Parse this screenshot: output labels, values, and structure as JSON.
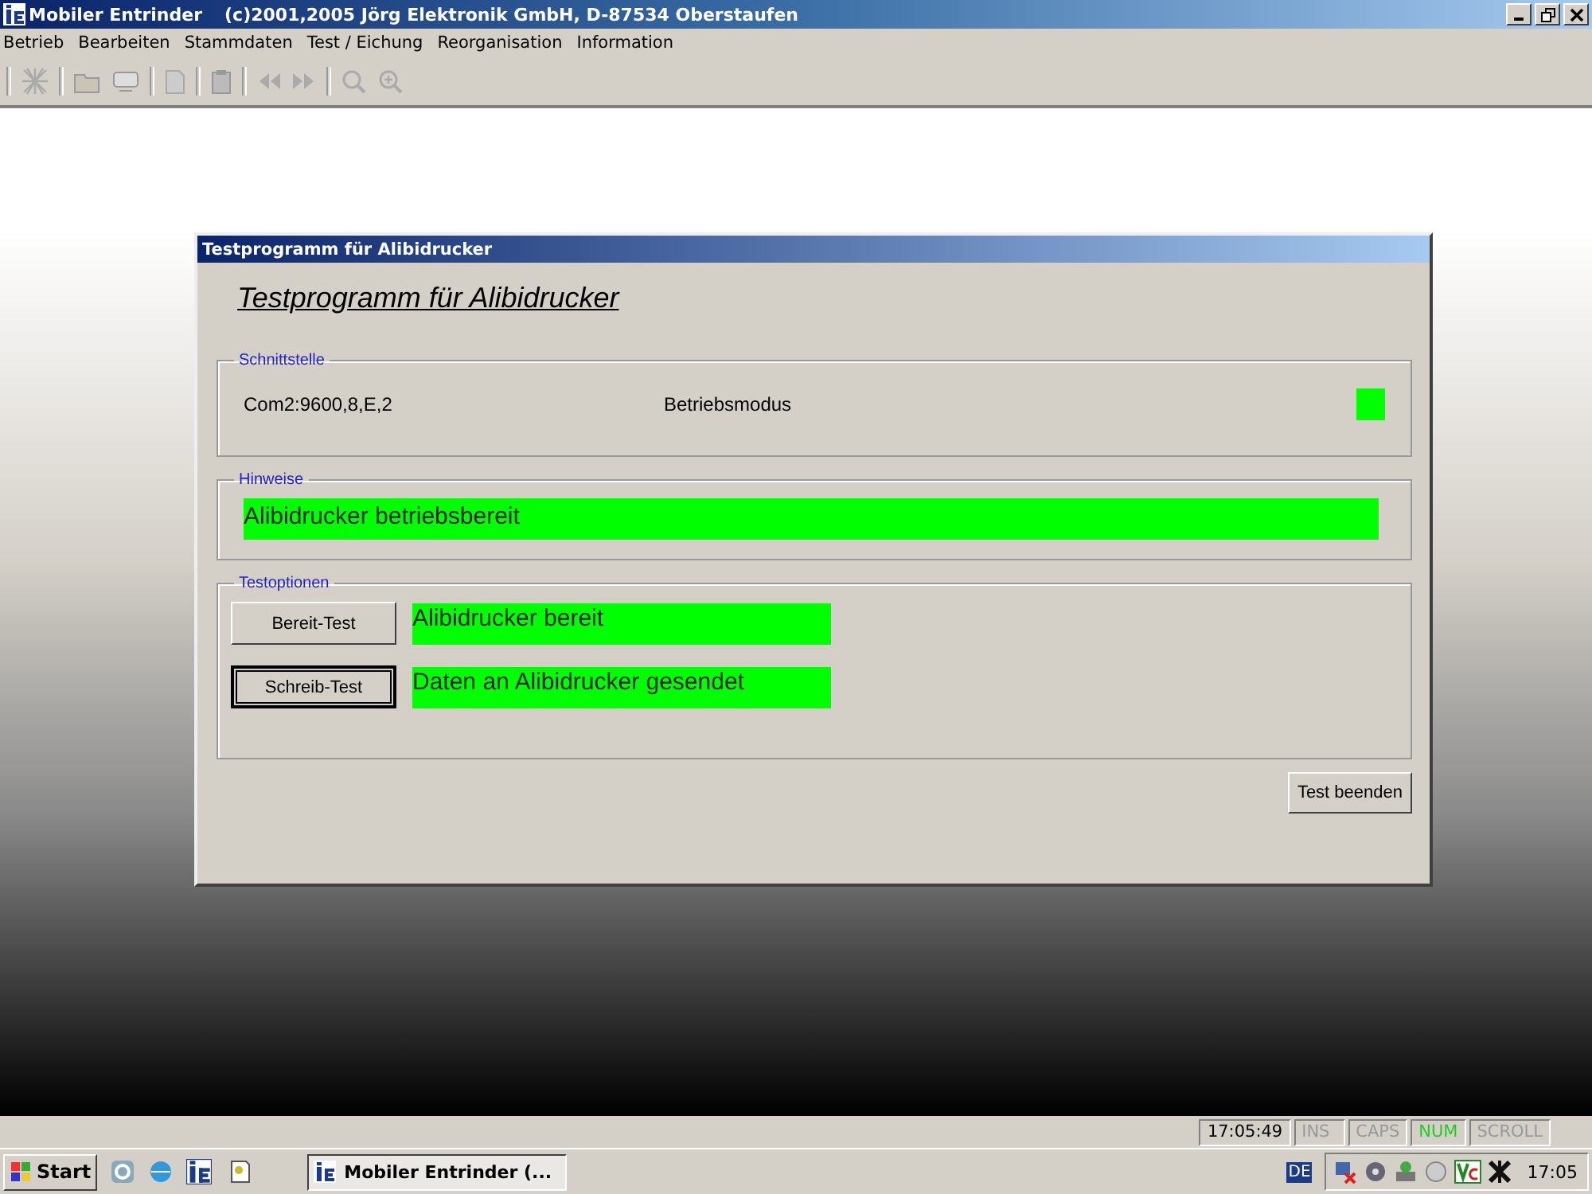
{
  "window": {
    "title": "Mobiler Entrinder",
    "subtitle": "(c)2001,2005  Jörg Elektronik GmbH, D-87534 Oberstaufen"
  },
  "menu": [
    "Betrieb",
    "Bearbeiten",
    "Stammdaten",
    "Test / Eichung",
    "Reorganisation",
    "Information"
  ],
  "dialog": {
    "title": "Testprogramm für Alibidrucker",
    "heading": "Testprogramm für Alibidrucker",
    "interface": {
      "legend": "Schnittstelle",
      "port": "Com2:9600,8,E,2",
      "mode_label": "Betriebsmodus",
      "mode_active": true
    },
    "hints": {
      "legend": "Hinweise",
      "message": "Alibidrucker betriebsbereit",
      "color": "#00ff00"
    },
    "tests": {
      "legend": "Testoptionen",
      "rows": [
        {
          "button": "Bereit-Test",
          "focused": false,
          "result": "Alibidrucker bereit",
          "color": "#00ff00"
        },
        {
          "button": "Schreib-Test",
          "focused": true,
          "result": "Daten an Alibidrucker gesendet",
          "color": "#00ff00"
        }
      ]
    },
    "close_button": "Test beenden"
  },
  "status_bar": {
    "time": "17:05:49",
    "indicators": [
      {
        "label": "INS",
        "on": false
      },
      {
        "label": "CAPS",
        "on": false
      },
      {
        "label": "NUM",
        "on": true
      },
      {
        "label": "SCROLL",
        "on": false
      }
    ]
  },
  "taskbar": {
    "start": "Start",
    "task": "Mobiler Entrinder (...",
    "language": "DE",
    "clock": "17:05"
  }
}
